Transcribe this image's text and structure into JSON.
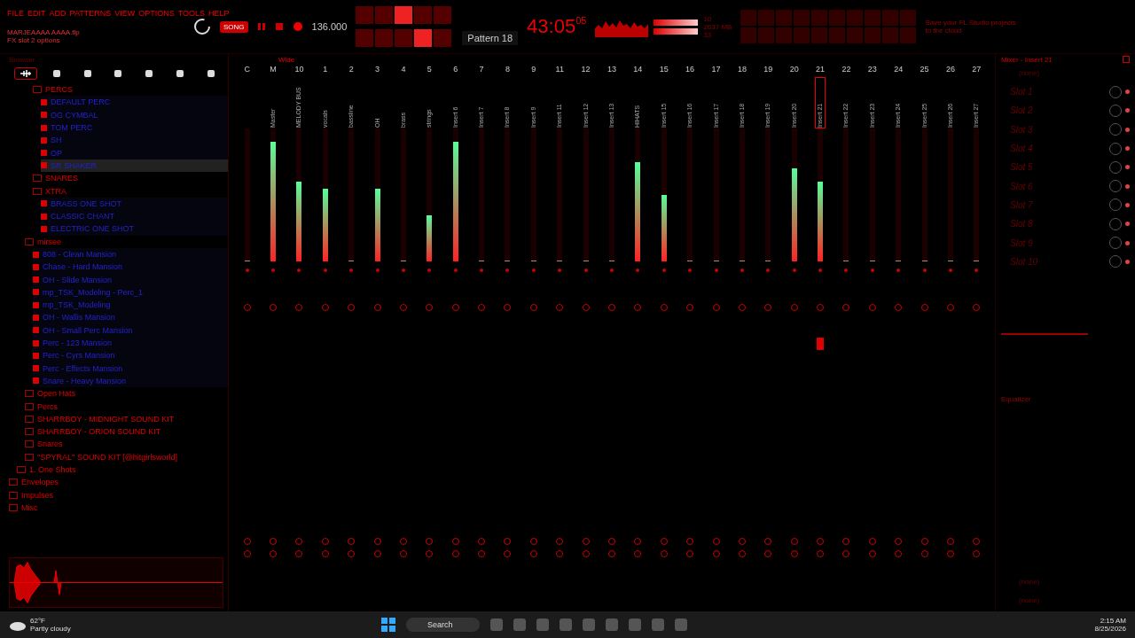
{
  "menu": [
    "FILE",
    "EDIT",
    "ADD",
    "PATTERNS",
    "VIEW",
    "OPTIONS",
    "TOOLS",
    "HELP"
  ],
  "project": {
    "file": "MARJEAAAA AAAA.flp",
    "hint": "FX slot 2 options"
  },
  "transport": {
    "mode": "SONG",
    "tempo": "136.000",
    "time": "43:05",
    "time_sub": "05"
  },
  "meter_readings": [
    "10",
    "2637 MB",
    "33"
  ],
  "pattern": "Pattern 18",
  "news": "Save your FL Studio projects to the cloud",
  "browser": {
    "title": "Browser",
    "tabs": [
      {
        "selected": true
      },
      {
        "selected": false
      },
      {
        "selected": false
      },
      {
        "selected": false
      },
      {
        "selected": false
      },
      {
        "selected": false
      },
      {
        "selected": false
      }
    ],
    "tree": [
      {
        "children": [
          {
            "children": [
              {
                "children": [
                  {
                    "label": "PERCS",
                    "kind": "folder",
                    "selected": false,
                    "children": [
                      {
                        "label": "DEFAULT PERC",
                        "kind": "file",
                        "selected": false
                      },
                      {
                        "label": "OG CYMBAL",
                        "kind": "file",
                        "selected": false
                      },
                      {
                        "label": "TOM PERC",
                        "kind": "file",
                        "selected": false
                      },
                      {
                        "label": "SH",
                        "kind": "file",
                        "selected": false
                      },
                      {
                        "label": "OP",
                        "kind": "file",
                        "selected": false
                      },
                      {
                        "label": "SR SHAKER",
                        "kind": "file",
                        "selected": true
                      }
                    ]
                  },
                  {
                    "label": "SNARES",
                    "kind": "folder",
                    "selected": false
                  },
                  {
                    "label": "XTRA",
                    "kind": "folder",
                    "selected": false,
                    "children": [
                      {
                        "label": "BRASS ONE SHOT",
                        "kind": "file",
                        "selected": false
                      },
                      {
                        "label": "CLASSIC CHANT",
                        "kind": "file",
                        "selected": false
                      },
                      {
                        "label": "ELECTRIC ONE SHOT",
                        "kind": "file",
                        "selected": false
                      }
                    ]
                  }
                ]
              },
              {
                "label": "mirsee",
                "kind": "folder",
                "selected": false,
                "children": [
                  {
                    "label": "808 - Clean Mansion",
                    "kind": "file",
                    "selected": false
                  },
                  {
                    "label": "Chase - Hard Mansion",
                    "kind": "file",
                    "selected": false
                  },
                  {
                    "label": "OH - Slide Mansion",
                    "kind": "file",
                    "selected": false
                  },
                  {
                    "label": "mp_TSK_Modeling - Perc_1",
                    "kind": "file",
                    "selected": false
                  },
                  {
                    "label": "mp_TSK_Modeling",
                    "kind": "file",
                    "selected": false
                  },
                  {
                    "label": "OH - Wallis Mansion",
                    "kind": "file",
                    "selected": false
                  },
                  {
                    "label": "OH - Small Perc Mansion",
                    "kind": "file",
                    "selected": false
                  },
                  {
                    "label": "Perc - 123 Mansion",
                    "kind": "file",
                    "selected": false
                  },
                  {
                    "label": "Perc - Cyrs Mansion",
                    "kind": "file",
                    "selected": false
                  },
                  {
                    "label": "Perc - Effects Mansion",
                    "kind": "file",
                    "selected": false
                  },
                  {
                    "label": "Snare - Heavy Mansion",
                    "kind": "file",
                    "selected": false
                  }
                ]
              },
              {
                "label": "Open Hats",
                "kind": "folder",
                "selected": false
              },
              {
                "label": "Percs",
                "kind": "folder",
                "selected": false
              },
              {
                "label": "SHARRBOY - MIDNIGHT SOUND KIT",
                "kind": "folder",
                "selected": false
              },
              {
                "label": "SHARRBOY - ORION SOUND KIT",
                "kind": "folder",
                "selected": false
              },
              {
                "label": "Snares",
                "kind": "folder",
                "selected": false
              },
              {
                "label": "''SPYRAL'' SOUND KIT [@hitgirlsworld]",
                "kind": "folder",
                "selected": false
              }
            ]
          },
          {
            "label": "1. One Shots",
            "kind": "folder",
            "selected": false
          }
        ]
      },
      {
        "label": "Envelopes",
        "kind": "folder",
        "selected": false
      },
      {
        "label": "Impulses",
        "kind": "folder",
        "selected": false
      },
      {
        "label": "Misc",
        "kind": "folder",
        "selected": false
      }
    ]
  },
  "mixer": {
    "mode": "Wide",
    "tracks": [
      {
        "num": "C",
        "level": 0,
        "selected": false
      },
      {
        "num": "M",
        "name": "Master",
        "level": 0.9,
        "selected": false
      },
      {
        "num": "10",
        "name": "MELODY BUS",
        "level": 0.6,
        "selected": false
      },
      {
        "num": "1",
        "name": "vocals",
        "level": 0.55,
        "selected": false
      },
      {
        "num": "2",
        "name": "bassline",
        "level": 0,
        "selected": false
      },
      {
        "num": "3",
        "name": "OH",
        "level": 0.55,
        "selected": false
      },
      {
        "num": "4",
        "name": "brass",
        "level": 0,
        "selected": false
      },
      {
        "num": "5",
        "name": "strings",
        "level": 0.35,
        "selected": false
      },
      {
        "num": "6",
        "name": "Insert 6",
        "level": 0.9,
        "selected": false
      },
      {
        "num": "7",
        "name": "Insert 7",
        "level": 0,
        "selected": false
      },
      {
        "num": "8",
        "name": "Insert 8",
        "level": 0,
        "selected": false
      },
      {
        "num": "9",
        "name": "Insert 9",
        "level": 0,
        "selected": false
      },
      {
        "num": "11",
        "name": "Insert 11",
        "level": 0,
        "selected": false
      },
      {
        "num": "12",
        "name": "Insert 12",
        "level": 0,
        "selected": false
      },
      {
        "num": "13",
        "name": "Insert 13",
        "level": 0,
        "selected": false
      },
      {
        "num": "14",
        "name": "HIHATS",
        "level": 0.75,
        "selected": false
      },
      {
        "num": "15",
        "name": "Insert 15",
        "level": 0.5,
        "selected": false
      },
      {
        "num": "16",
        "name": "Insert 16",
        "level": 0,
        "selected": false
      },
      {
        "num": "17",
        "name": "Insert 17",
        "level": 0,
        "selected": false
      },
      {
        "num": "18",
        "name": "Insert 18",
        "level": 0,
        "selected": false
      },
      {
        "num": "19",
        "name": "Insert 19",
        "level": 0,
        "selected": false
      },
      {
        "num": "20",
        "name": "Insert 20",
        "level": 0.7,
        "selected": false
      },
      {
        "num": "21",
        "name": "Insert 21",
        "level": 0.6,
        "selected": true
      },
      {
        "num": "22",
        "name": "Insert 22",
        "level": 0,
        "selected": false
      },
      {
        "num": "23",
        "name": "Insert 23",
        "level": 0,
        "selected": false
      },
      {
        "num": "24",
        "name": "Insert 24",
        "level": 0,
        "selected": false
      },
      {
        "num": "25",
        "name": "Insert 25",
        "level": 0,
        "selected": false
      },
      {
        "num": "26",
        "name": "Insert 26",
        "level": 0,
        "selected": false
      },
      {
        "num": "27",
        "name": "Insert 27",
        "level": 0,
        "selected": false
      }
    ]
  },
  "insert_panel": {
    "title": "Mixer - Insert 21",
    "input": "(none)",
    "slots": [
      "Slot 1",
      "Slot 2",
      "Slot 3",
      "Slot 4",
      "Slot 5",
      "Slot 6",
      "Slot 7",
      "Slot 8",
      "Slot 9",
      "Slot 10"
    ],
    "eq": "Equalizer",
    "outputs": [
      "(none)",
      "(none)"
    ]
  },
  "taskbar": {
    "temp": "62°F",
    "weather": "Partly cloudy",
    "search": "Search",
    "time": "2:15 AM",
    "date": "8/25/2026"
  }
}
